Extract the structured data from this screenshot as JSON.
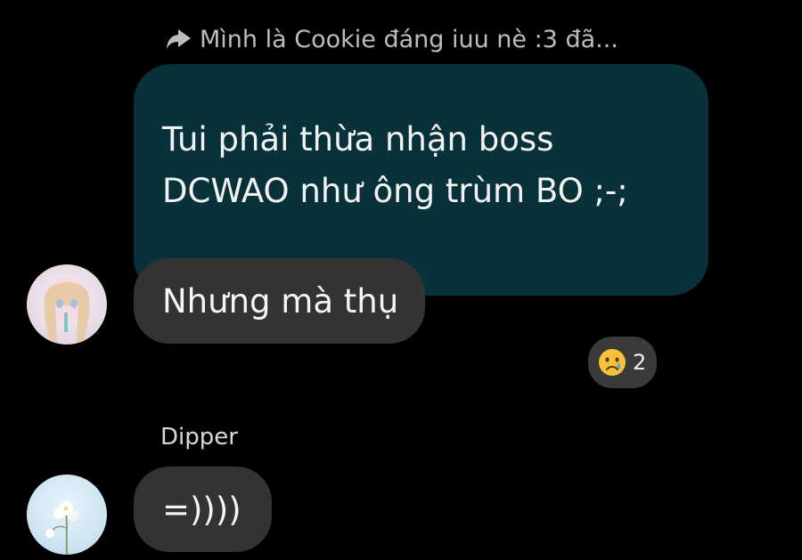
{
  "reply_header": {
    "icon": "reply-arrow-icon",
    "text": "Mình là Cookie đáng iuu nè :3 đã..."
  },
  "quoted_message": {
    "line1": "Tui phải thừa nhận boss",
    "line2": "DCWAO như ông trùm BO ;-;"
  },
  "messages": [
    {
      "text": "Nhưng mà thụ"
    },
    {
      "sender": "Dipper",
      "text": "=))))"
    }
  ],
  "reaction": {
    "emoji_icon": "crying-face-icon",
    "count": "2"
  },
  "colors": {
    "background": "#000000",
    "quoted_bubble": "#08313a",
    "message_bubble": "#333333"
  }
}
